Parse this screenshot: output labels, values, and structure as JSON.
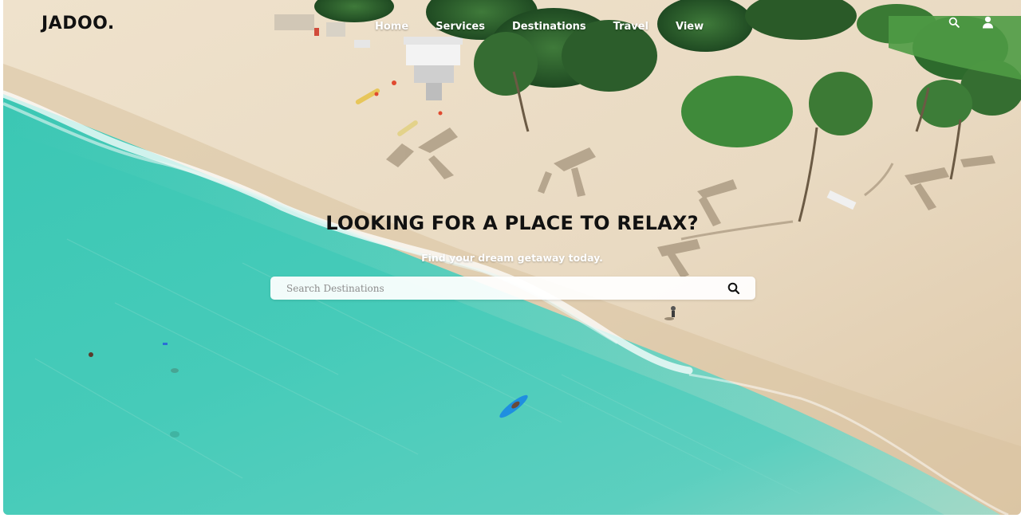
{
  "brand": {
    "logo": "JADOO."
  },
  "nav": {
    "links": [
      "Home",
      "Services",
      "Destinations",
      "Travel",
      "View"
    ],
    "icons": [
      "search-icon",
      "user-icon"
    ]
  },
  "hero": {
    "title": "LOOKING FOR A PLACE TO RELAX?",
    "subtitle": "Find your dream getaway today."
  },
  "search": {
    "placeholder": "Search Destinations",
    "value": "",
    "icon": "search-icon"
  },
  "colors": {
    "title_text": "#111111",
    "nav_text": "#ffffff",
    "sea": "#2ec4b0",
    "sand": "#e6d3b6"
  }
}
